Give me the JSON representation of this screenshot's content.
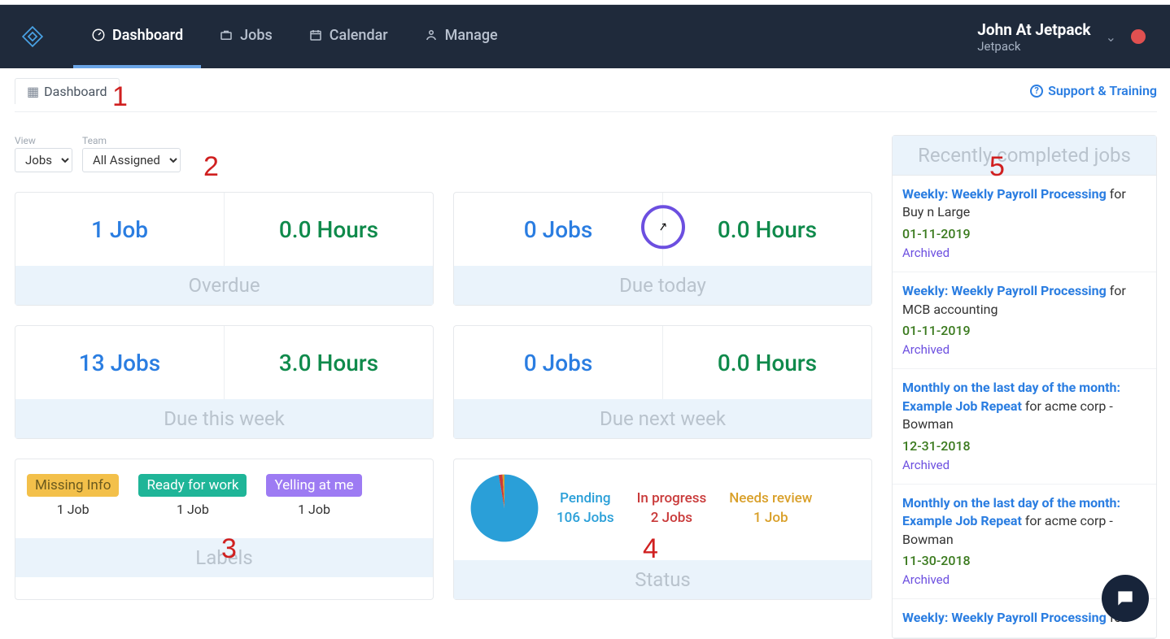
{
  "nav": {
    "tabs": [
      {
        "label": "Dashboard",
        "active": true
      },
      {
        "label": "Jobs",
        "active": false
      },
      {
        "label": "Calendar",
        "active": false
      },
      {
        "label": "Manage",
        "active": false
      }
    ],
    "user_name": "John At Jetpack",
    "company": "Jetpack"
  },
  "page_tab": "Dashboard",
  "support_link": "Support & Training",
  "filters": {
    "view_label": "View",
    "view_value": "Jobs",
    "team_label": "Team",
    "team_value": "All Assigned"
  },
  "stats": {
    "overdue": {
      "jobs": "1 Job",
      "hours": "0.0 Hours",
      "foot": "Overdue"
    },
    "today": {
      "jobs": "0 Jobs",
      "hours": "0.0 Hours",
      "foot": "Due today"
    },
    "thisweek": {
      "jobs": "13 Jobs",
      "hours": "3.0 Hours",
      "foot": "Due this week"
    },
    "nextweek": {
      "jobs": "0 Jobs",
      "hours": "0.0 Hours",
      "foot": "Due next week"
    }
  },
  "labels_card": {
    "foot": "Labels",
    "items": [
      {
        "tag": "Missing Info",
        "color": "#f3c04a",
        "count": "1 Job"
      },
      {
        "tag": "Ready for work",
        "color": "#1fb598",
        "count": "1 Job"
      },
      {
        "tag": "Yelling at me",
        "color": "#9d7bf3",
        "count": "1 Job"
      }
    ]
  },
  "status_card": {
    "foot": "Status",
    "items": [
      {
        "label": "Pending",
        "color": "#2a9fd8",
        "count": "106 Jobs"
      },
      {
        "label": "In progress",
        "color": "#c93a3a",
        "count": "2 Jobs"
      },
      {
        "label": "Needs review",
        "color": "#d9a02a",
        "count": "1 Job"
      }
    ]
  },
  "chart_data": {
    "type": "pie",
    "title": "Status",
    "series": [
      {
        "name": "Pending",
        "value": 106,
        "color": "#2a9fd8"
      },
      {
        "name": "In progress",
        "value": 2,
        "color": "#c93a3a"
      },
      {
        "name": "Needs review",
        "value": 1,
        "color": "#d9a02a"
      }
    ]
  },
  "recent": {
    "title": "Recently completed jobs",
    "items": [
      {
        "title": "Weekly: Weekly Payroll Processing",
        "for": " for Buy n Large",
        "date": "01-11-2019",
        "status": "Archived"
      },
      {
        "title": "Weekly: Weekly Payroll Processing",
        "for": " for MCB accounting",
        "date": "01-11-2019",
        "status": "Archived"
      },
      {
        "title": "Monthly on the last day of the month: Example Job Repeat",
        "for": " for acme corp - Bowman",
        "date": "12-31-2018",
        "status": "Archived"
      },
      {
        "title": "Monthly on the last day of the month: Example Job Repeat",
        "for": " for acme corp - Bowman",
        "date": "11-30-2018",
        "status": "Archived"
      },
      {
        "title": "Weekly: Weekly Payroll Processing",
        "for": " for",
        "date": "",
        "status": ""
      }
    ]
  },
  "annotations": {
    "1": "1",
    "2": "2",
    "3": "3",
    "4": "4",
    "5": "5"
  }
}
